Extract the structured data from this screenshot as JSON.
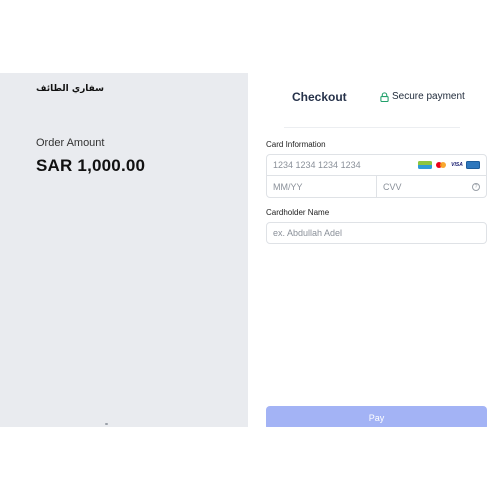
{
  "merchant": {
    "name": "سفاري الطائف"
  },
  "order": {
    "label": "Order Amount",
    "amount": "SAR 1,000.00"
  },
  "header": {
    "tab": "Checkout",
    "secure_label": "Secure payment"
  },
  "card": {
    "section_label": "Card Information",
    "number_placeholder": "1234 1234 1234 1234",
    "expiry_placeholder": "MM/YY",
    "cvv_placeholder": "CVV",
    "brand_icons": [
      "mada-icon",
      "mastercard-icon",
      "visa-icon",
      "amex-icon"
    ],
    "visa_text": "VISA"
  },
  "cardholder": {
    "label": "Cardholder Name",
    "placeholder": "ex. Abdullah Adel"
  },
  "pay": {
    "label": "Pay",
    "color": "#a3b3f5"
  },
  "colors": {
    "left_panel": "#e9ebef",
    "secure_lock": "#22a06b"
  }
}
